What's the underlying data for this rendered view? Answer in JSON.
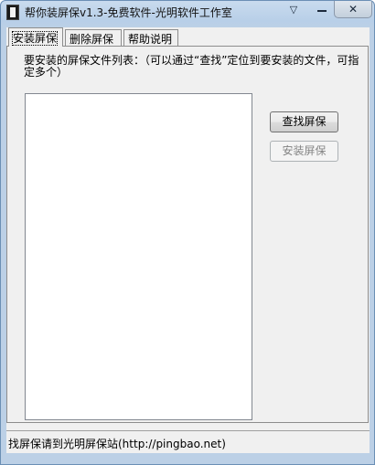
{
  "window": {
    "title": "帮你装屏保v1.3-免费软件-光明软件工作室",
    "icon": "screensaver-app-icon",
    "controls": {
      "dropdown": "▽",
      "minimize": "minimize-icon",
      "close": "✕"
    }
  },
  "tabs": [
    {
      "label": "安装屏保",
      "active": true
    },
    {
      "label": "删除屏保",
      "active": false
    },
    {
      "label": "帮助说明",
      "active": false
    }
  ],
  "install_panel": {
    "instruction": "要安装的屏保文件列表：（可以通过“查找”定位到要安装的文件，可指定多个）",
    "file_list_items": [],
    "find_button": "查找屏保",
    "install_button": "安装屏保",
    "install_button_enabled": false
  },
  "status_bar": {
    "text": "找屏保请到光明屏保站(http://pingbao.net)"
  },
  "colors": {
    "frame": "#bcd0e6",
    "panel": "#f0f0f0",
    "disabled_text": "#838383"
  }
}
